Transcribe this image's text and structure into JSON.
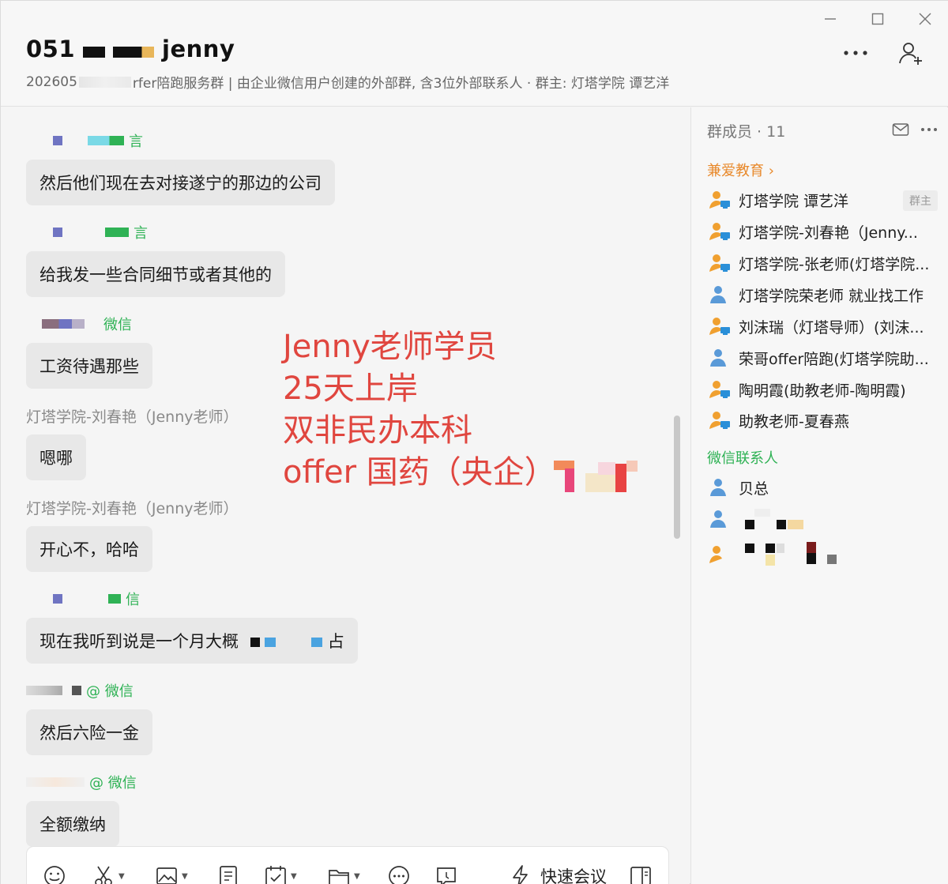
{
  "header": {
    "title_prefix": "051",
    "title_suffix": "jenny",
    "subtitle_prefix": "202605",
    "subtitle_main": "rfer陪跑服务群 | 由企业微信用户创建的外部群, 含3位外部联系人 · 群主: 灯塔学院 谭艺洋",
    "more_label": "···"
  },
  "window_controls": {
    "minimize": "—",
    "maximize": "☐",
    "close": "✕"
  },
  "messages": [
    {
      "sender_suffix": "言",
      "text": "然后他们现在去对接遂宁的那边的公司"
    },
    {
      "sender_suffix": "言",
      "text": "给我发一些合同细节或者其他的"
    },
    {
      "sender_suffix": "微信",
      "text": "工资待遇那些"
    },
    {
      "sender": "灯塔学院-刘春艳（Jenny老师）",
      "text": "嗯哪"
    },
    {
      "sender": "灯塔学院-刘春艳（Jenny老师）",
      "text": "开心不，哈哈"
    },
    {
      "sender_suffix": "信",
      "text": "现在我听到说是一个月大概",
      "text_tail": "占"
    },
    {
      "sender_suffix": "@ 微信",
      "text": "然后六险一金"
    },
    {
      "sender_suffix": "@ 微信",
      "text": "全额缴纳"
    }
  ],
  "overlay": {
    "line1": "Jenny老师学员",
    "line2": "25天上岸",
    "line3": "双非民办本科",
    "line4": "offer 国药（央企）",
    "color": "#e0463f"
  },
  "toolbar": {
    "quick_meeting": "快速会议",
    "icons": [
      "emoji-icon",
      "scissors-icon",
      "image-icon",
      "document-icon",
      "calendar-check-icon",
      "folder-icon",
      "chat-more-icon",
      "comment-icon",
      "lightning-icon",
      "sidebar-toggle-icon"
    ]
  },
  "sidebar": {
    "members_label": "群成员 · 11",
    "org_label": "兼爱教育 ›",
    "owner_badge": "群主",
    "org_members": [
      "灯塔学院 谭艺洋",
      "灯塔学院-刘春艳（Jenny...",
      "灯塔学院-张老师(灯塔学院...",
      "灯塔学院荣老师 就业找工作",
      "刘沫瑞（灯塔导师）(刘沫...",
      "荣哥offer陪跑(灯塔学院助...",
      "陶明霞(助教老师-陶明霞)",
      "助教老师-夏春燕"
    ],
    "wechat_label": "微信联系人",
    "wechat_members": [
      "贝总"
    ]
  },
  "colors": {
    "accent_orange": "#e8892b",
    "accent_green": "#2fb255",
    "bubble": "#e8e8e8"
  }
}
